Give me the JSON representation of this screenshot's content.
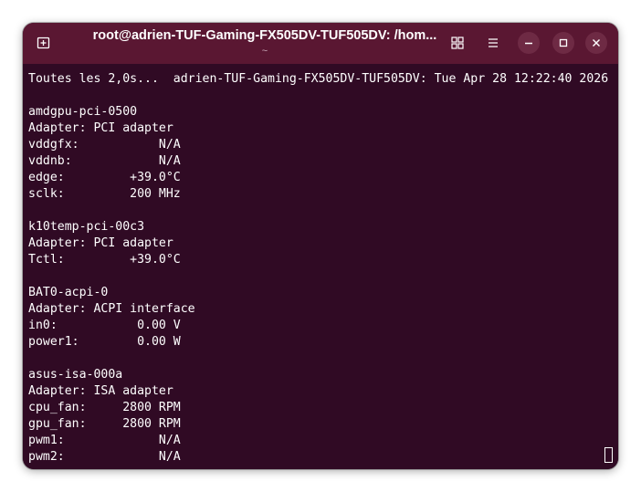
{
  "window": {
    "title": "root@adrien-TUF-Gaming-FX505DV-TUF505DV: /hom...",
    "subtitle": "~"
  },
  "titlebar_icons": {
    "new_tab": "new-tab-icon",
    "view_tabs": "grid-icon",
    "menu": "hamburger-icon",
    "minimize": "minimize-icon",
    "maximize": "maximize-icon",
    "close": "close-icon"
  },
  "colors": {
    "terminal_background": "#300a24",
    "titlebar_background": "#5a1732",
    "text": "#ffffff"
  },
  "terminal": {
    "lines": [
      "Toutes les 2,0s...  adrien-TUF-Gaming-FX505DV-TUF505DV: Tue Apr 28 12:22:40 2026",
      "",
      "amdgpu-pci-0500",
      "Adapter: PCI adapter",
      "vddgfx:           N/A",
      "vddnb:            N/A",
      "edge:         +39.0°C",
      "sclk:         200 MHz",
      "",
      "k10temp-pci-00c3",
      "Adapter: PCI adapter",
      "Tctl:         +39.0°C",
      "",
      "BAT0-acpi-0",
      "Adapter: ACPI interface",
      "in0:           0.00 V",
      "power1:        0.00 W",
      "",
      "asus-isa-000a",
      "Adapter: ISA adapter",
      "cpu_fan:     2800 RPM",
      "gpu_fan:     2800 RPM",
      "pwm1:             N/A",
      "pwm2:             N/A"
    ]
  }
}
